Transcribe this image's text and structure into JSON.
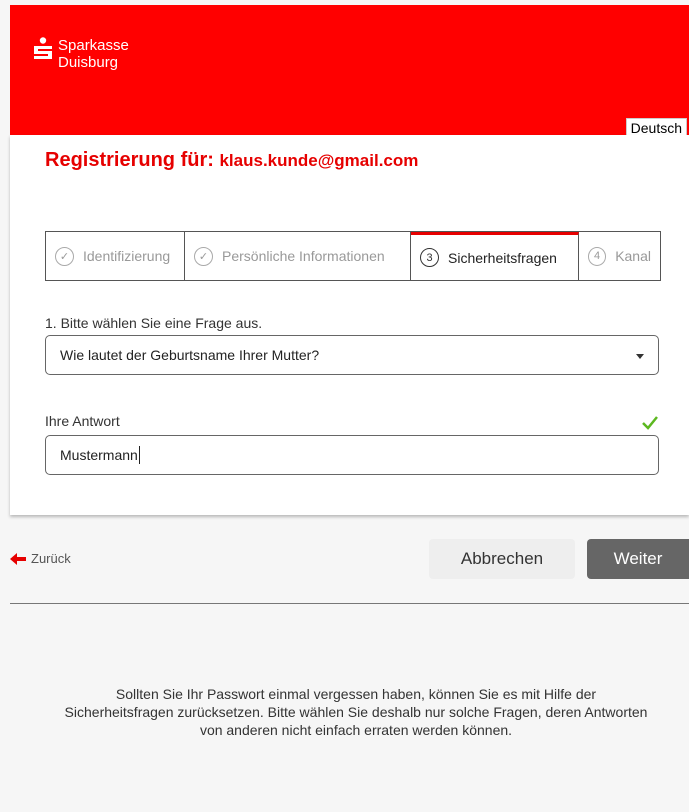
{
  "header": {
    "brand_line1": "Sparkasse",
    "brand_line2": "Duisburg",
    "language_button": "Deutsch",
    "color": "#ff0000"
  },
  "registration": {
    "title_prefix": "Registrierung für:",
    "email": "klaus.kunde@gmail.com"
  },
  "steps": [
    {
      "number": "✓",
      "label": "Identifizierung",
      "state": "done"
    },
    {
      "number": "✓",
      "label": "Persönliche Informationen",
      "state": "done"
    },
    {
      "number": "3",
      "label": "Sicherheitsfragen",
      "state": "active"
    },
    {
      "number": "4",
      "label": "Kanal",
      "state": "upcoming"
    }
  ],
  "question": {
    "label": "1. Bitte wählen Sie eine Frage aus.",
    "selected": "Wie lautet der Geburtsname Ihrer Mutter?"
  },
  "answer": {
    "label": "Ihre Antwort",
    "value": "Mustermann",
    "valid_icon": "check-icon"
  },
  "actions": {
    "back": "Zurück",
    "cancel": "Abbrechen",
    "next": "Weiter"
  },
  "info_text": "Sollten Sie Ihr Passwort einmal vergessen haben, können Sie es mit Hilfe der Sicherheitsfragen zurücksetzen. Bitte wählen Sie deshalb nur solche Fragen, deren Antworten von anderen nicht einfach erraten werden können."
}
